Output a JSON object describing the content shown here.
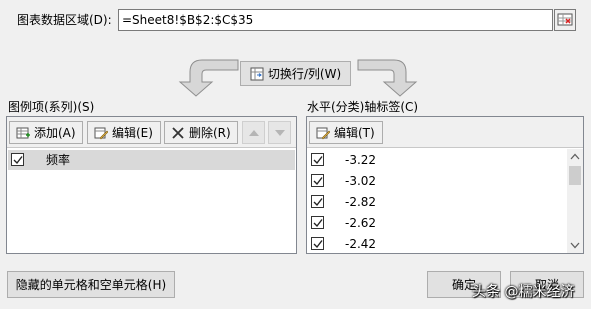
{
  "range": {
    "label": "图表数据区域(D):",
    "value": "=Sheet8!$B$2:$C$35"
  },
  "switch_button": "切换行/列(W)",
  "series": {
    "title": "图例项(系列)(S)",
    "add_label": "添加(A)",
    "edit_label": "编辑(E)",
    "delete_label": "删除(R)",
    "items": [
      {
        "label": "频率",
        "checked": true
      }
    ]
  },
  "axis": {
    "title": "水平(分类)轴标签(C)",
    "edit_label": "编辑(T)",
    "items": [
      {
        "label": "-3.22",
        "checked": true
      },
      {
        "label": "-3.02",
        "checked": true
      },
      {
        "label": "-2.82",
        "checked": true
      },
      {
        "label": "-2.62",
        "checked": true
      },
      {
        "label": "-2.42",
        "checked": true
      }
    ]
  },
  "hidden_cells_button": "隐藏的单元格和空单元格(H)",
  "ok_button": "确定",
  "cancel_button": "取消",
  "watermark": "头条 @糯米经济"
}
